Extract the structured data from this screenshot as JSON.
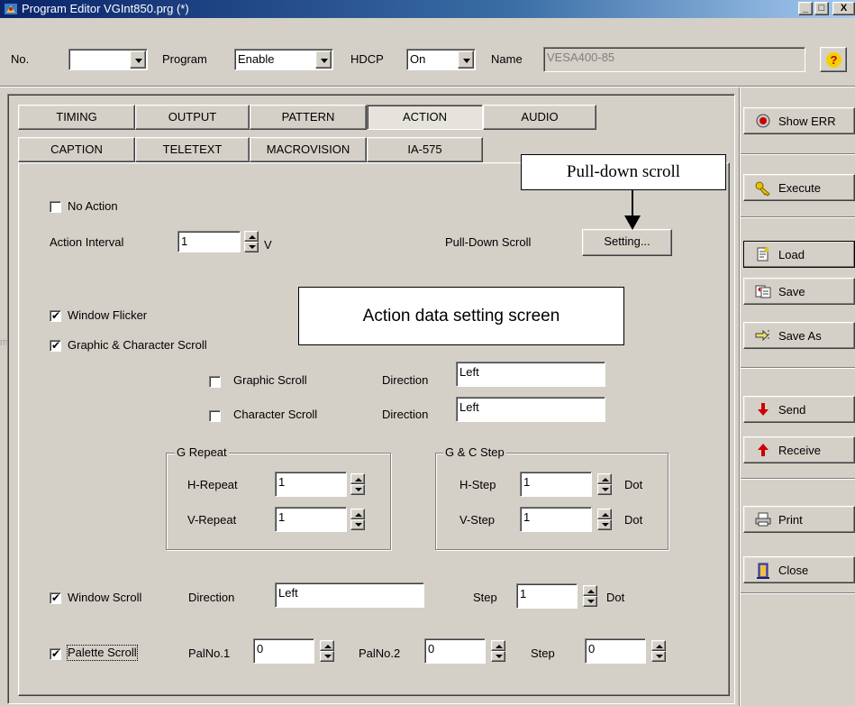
{
  "window": {
    "title": "Program Editor VGInt850.prg (*)",
    "minimize": "_",
    "maximize": "□",
    "close": "X"
  },
  "topbar": {
    "no_label": "No.",
    "no_value": "",
    "program_label": "Program",
    "program_value": "Enable",
    "hdcp_label": "HDCP",
    "hdcp_value": "On",
    "name_label": "Name",
    "name_value": "VESA400-85",
    "help": "?"
  },
  "tabs": {
    "row1": [
      "TIMING",
      "OUTPUT",
      "PATTERN",
      "ACTION",
      "AUDIO"
    ],
    "row2": [
      "CAPTION",
      "TELETEXT",
      "MACROVISION",
      "IA-575"
    ]
  },
  "action": {
    "no_action": "No Action",
    "interval_label": "Action Interval",
    "interval_value": "1",
    "interval_unit": "V",
    "pulldown_label": "Pull-Down Scroll",
    "pulldown_button": "Setting...",
    "window_flicker": "Window Flicker",
    "gc_scroll": "Graphic & Character Scroll",
    "graphic_scroll": "Graphic Scroll",
    "character_scroll": "Character Scroll",
    "direction_label": "Direction",
    "graphic_direction": "Left",
    "character_direction": "Left",
    "g_repeat": {
      "title": "G Repeat",
      "h_label": "H-Repeat",
      "h_value": "1",
      "v_label": "V-Repeat",
      "v_value": "1"
    },
    "gc_step": {
      "title": "G & C Step",
      "h_label": "H-Step",
      "h_value": "1",
      "v_label": "V-Step",
      "v_value": "1",
      "unit": "Dot"
    },
    "window_scroll": "Window Scroll",
    "ws_direction_label": "Direction",
    "ws_direction": "Left",
    "ws_step_label": "Step",
    "ws_step": "1",
    "ws_unit": "Dot",
    "palette_scroll": "Palette Scroll",
    "pal1_label": "PalNo.1",
    "pal1_value": "0",
    "pal2_label": "PalNo.2",
    "pal2_value": "0",
    "pal_step_label": "Step",
    "pal_step": "0"
  },
  "sidebar": {
    "show_err": "Show ERR",
    "execute": "Execute",
    "load": "Load",
    "save": "Save",
    "save_as": "Save As",
    "send": "Send",
    "receive": "Receive",
    "print": "Print",
    "close": "Close"
  },
  "annotations": {
    "pulldown": "Pull-down scroll",
    "action_screen": "Action data setting screen"
  },
  "edge_char": "m",
  "colors": {
    "face": "#d4d0c8",
    "title_start": "#0a246a",
    "title_end": "#a6caf0",
    "send_arrow": "#cc0000",
    "err_dot": "#cc0000"
  }
}
